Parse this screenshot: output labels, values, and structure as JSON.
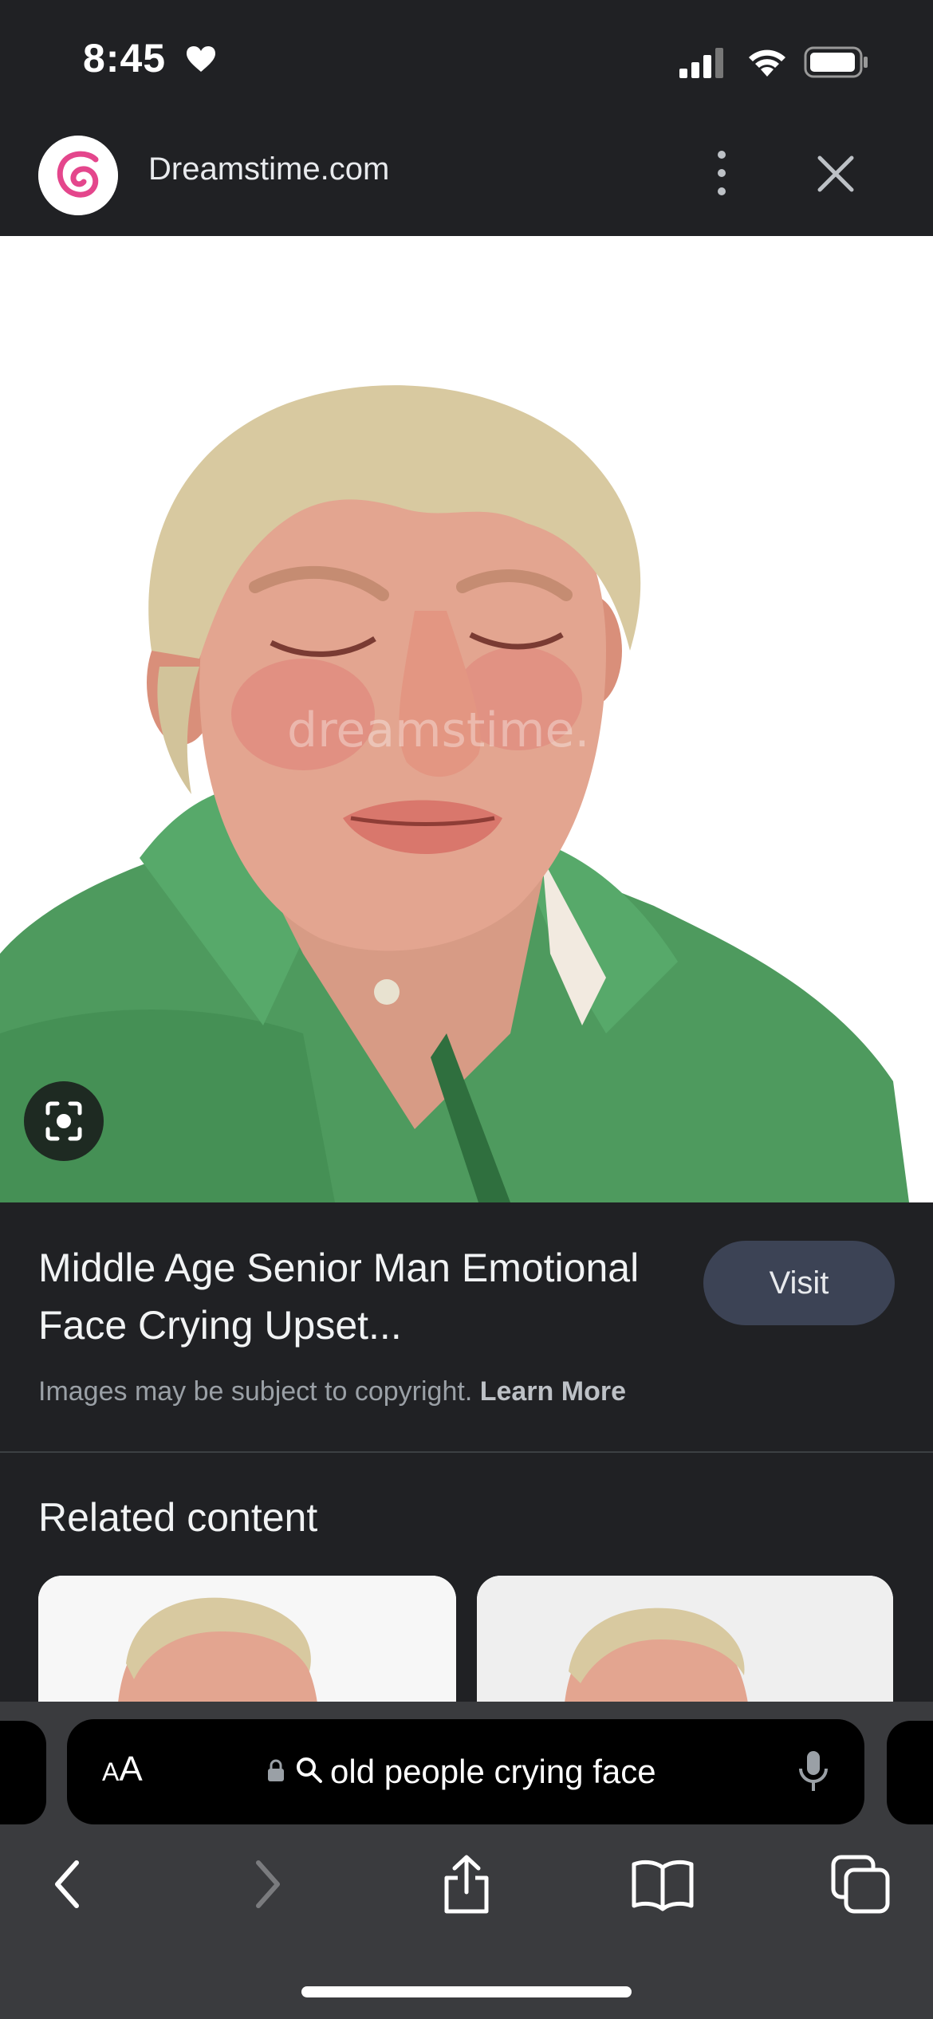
{
  "status_bar": {
    "time": "8:45",
    "icons": [
      "heart-icon",
      "signal-icon",
      "wifi-icon",
      "battery-icon"
    ]
  },
  "site": {
    "name": "Dreamstime.com",
    "logo_icon": "dreamstime-logo-icon",
    "brand_color": "#e4468c"
  },
  "image": {
    "description_icon": "google-lens-icon",
    "watermark": "dreamstime."
  },
  "result": {
    "title": "Middle Age Senior Man Emotional Face Crying Upset...",
    "visit_label": "Visit",
    "copyright_text": "Images may be subject to copyright.",
    "learn_more_label": "Learn More"
  },
  "related": {
    "heading": "Related content"
  },
  "browser": {
    "aa_label_small": "A",
    "aa_label_large": "A",
    "search_query": "old people crying face",
    "toolbar": [
      "back-icon",
      "forward-icon",
      "share-icon",
      "bookmarks-icon",
      "tabs-icon"
    ]
  },
  "colors": {
    "background": "#202124",
    "visit_button": "#3c4355",
    "bottom_bar": "#3a3b3e",
    "shirt_green": "#4e9a5e"
  }
}
